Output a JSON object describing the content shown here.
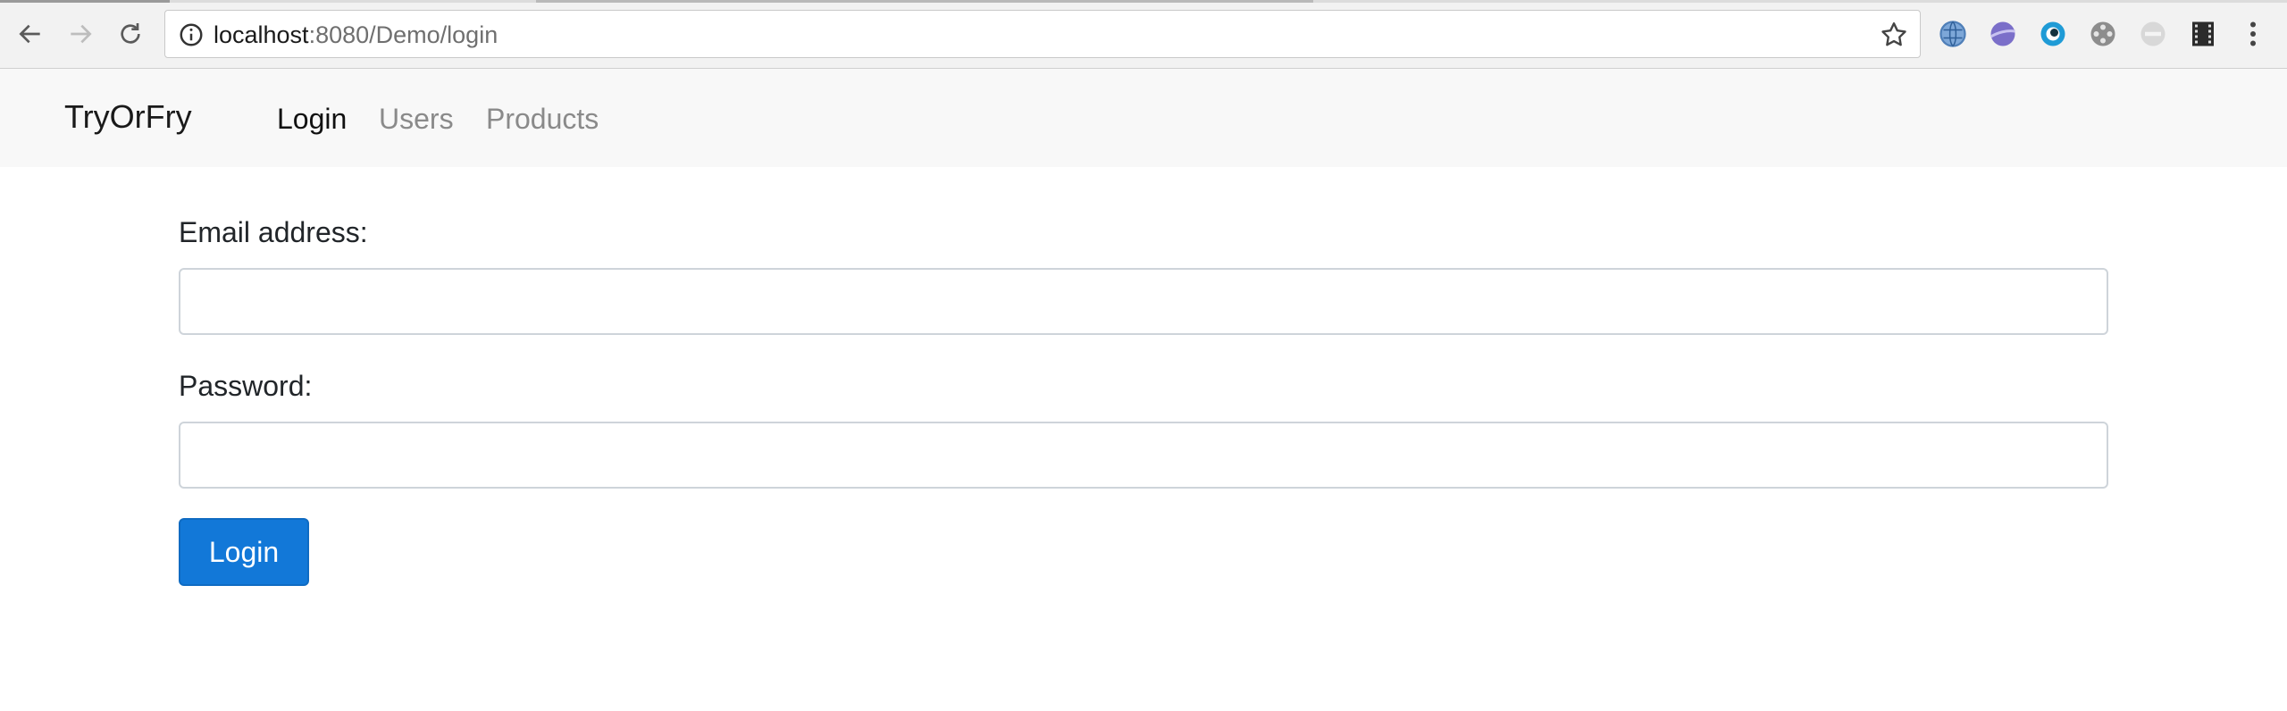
{
  "browser": {
    "url_host": "localhost",
    "url_rest": ":8080/Demo/login",
    "icons": [
      "back-icon",
      "forward-icon",
      "reload-icon",
      "info-icon",
      "star-icon",
      "extension-icons"
    ]
  },
  "navbar": {
    "brand": "TryOrFry",
    "links": [
      {
        "label": "Login",
        "active": true
      },
      {
        "label": "Users",
        "active": false
      },
      {
        "label": "Products",
        "active": false
      }
    ]
  },
  "form": {
    "email_label": "Email address:",
    "email_value": "",
    "password_label": "Password:",
    "password_value": "",
    "submit_label": "Login"
  },
  "colors": {
    "primary": "#1278d8",
    "navbar_bg": "#f8f8f8",
    "active_link": "#111111",
    "inactive_link": "#8a8a8a"
  }
}
